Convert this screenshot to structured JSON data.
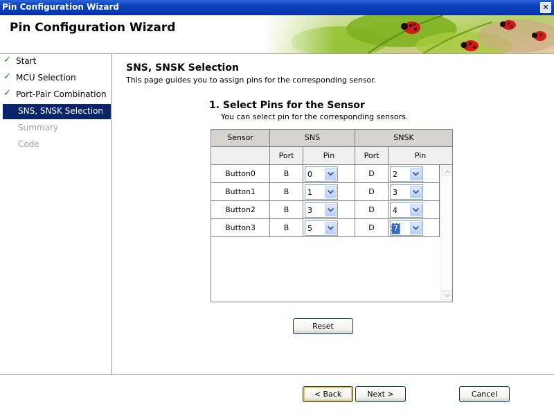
{
  "window": {
    "title": "Pin Configuration Wizard"
  },
  "header": {
    "title": "Pin Configuration Wizard"
  },
  "sidebar": {
    "steps": [
      {
        "label": "Start"
      },
      {
        "label": "MCU Selection"
      },
      {
        "label": "Port-Pair Combination"
      },
      {
        "label": "SNS, SNSK Selection"
      },
      {
        "label": "Summary"
      },
      {
        "label": "Code"
      }
    ]
  },
  "page": {
    "title": "SNS, SNSK Selection",
    "description": "This page guides you to assign pins for the corresponding sensor.",
    "section_title": "1. Select Pins for the Sensor",
    "section_description": "You can select pin for the corresponding sensors."
  },
  "table": {
    "headers": {
      "sensor": "Sensor",
      "sns": "SNS",
      "snsk": "SNSK",
      "port": "Port",
      "pin": "Pin"
    },
    "rows": [
      {
        "sensor": "Button0",
        "sns_port": "B",
        "sns_pin": "0",
        "snsk_port": "D",
        "snsk_pin": "2"
      },
      {
        "sensor": "Button1",
        "sns_port": "B",
        "sns_pin": "1",
        "snsk_port": "D",
        "snsk_pin": "3"
      },
      {
        "sensor": "Button2",
        "sns_port": "B",
        "sns_pin": "3",
        "snsk_port": "D",
        "snsk_pin": "4"
      },
      {
        "sensor": "Button3",
        "sns_port": "B",
        "sns_pin": "5",
        "snsk_port": "D",
        "snsk_pin": "7"
      }
    ]
  },
  "buttons": {
    "reset": "Reset",
    "back": "< Back",
    "next": "Next >",
    "cancel": "Cancel"
  },
  "colors": {
    "titlebar": "#0a3fbf",
    "active_step": "#0a246a",
    "check": "#1b7a1b",
    "selection": "#316ac5"
  }
}
